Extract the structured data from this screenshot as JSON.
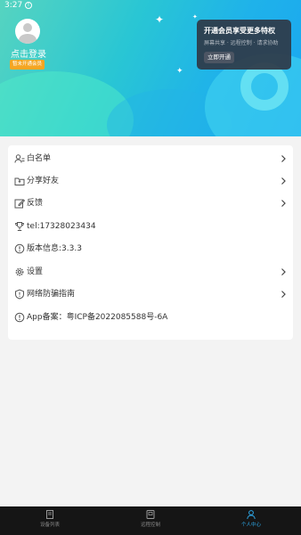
{
  "status_bar": {
    "time": "3:27",
    "alert": "!"
  },
  "profile": {
    "login_text": "点击登录",
    "vip_badge": "暂未开通会员"
  },
  "vip_card": {
    "title": "开通会员享受更多特权",
    "subtitle": "屏幕共享 · 远程控制 · 请求协助",
    "button": "立即开通"
  },
  "menu": {
    "items": [
      {
        "label": "白名单",
        "icon": "user-list-icon",
        "has_arrow": true
      },
      {
        "label": "分享好友",
        "icon": "share-folder-icon",
        "has_arrow": true
      },
      {
        "label": "反馈",
        "icon": "edit-icon",
        "has_arrow": true
      },
      {
        "label": "tel:17328023434",
        "icon": "trophy-icon",
        "has_arrow": false
      },
      {
        "label": "版本信息:3.3.3",
        "icon": "info-icon",
        "has_arrow": false
      },
      {
        "label": "设置",
        "icon": "gear-icon",
        "has_arrow": true
      },
      {
        "label": "网络防骗指南",
        "icon": "shield-icon",
        "has_arrow": true
      },
      {
        "label": "App备案：粤ICP备2022085588号-6A",
        "icon": "info-icon",
        "has_arrow": false
      }
    ]
  },
  "tabbar": {
    "tabs": [
      {
        "label": "设备列表",
        "icon": "device-list-icon",
        "active": false
      },
      {
        "label": "远程控制",
        "icon": "remote-control-icon",
        "active": false
      },
      {
        "label": "个人中心",
        "icon": "person-icon",
        "active": true
      }
    ]
  },
  "colors": {
    "accent": "#2ea8e8",
    "header_start": "#56d4c0",
    "header_end": "#1aa6f0",
    "vip_badge": "#f5a623",
    "tabbar_bg": "#151515"
  }
}
